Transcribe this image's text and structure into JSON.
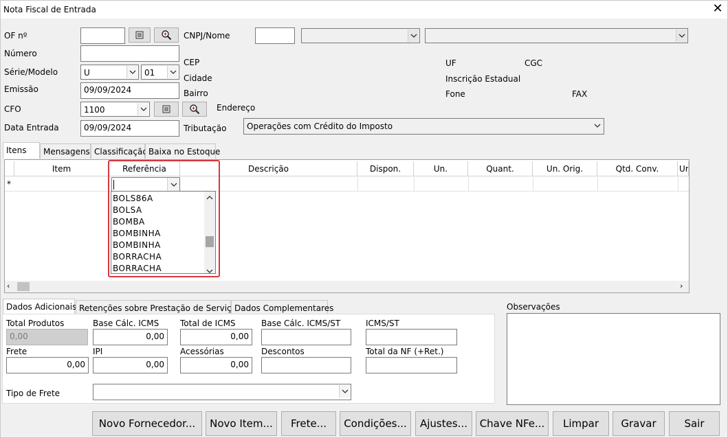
{
  "window": {
    "title": "Nota Fiscal de Entrada",
    "close": "✕"
  },
  "header": {
    "of_label": "OF nº",
    "numero_label": "Número",
    "serie_label": "Série/Modelo",
    "serie_value": "U",
    "modelo_value": "01",
    "emissao_label": "Emissão",
    "emissao_value": "09/09/2024",
    "cfo_label": "CFO",
    "cfo_value": "1100",
    "data_entrada_label": "Data Entrada",
    "data_entrada_value": "09/09/2024",
    "cnpj_label": "CNPJ/Nome",
    "cep_label": "CEP",
    "cidade_label": "Cidade",
    "bairro_label": "Bairro",
    "endereco_label": "Endereço",
    "tributacao_label": "Tributação",
    "tributacao_value": "Operações com Crédito do Imposto",
    "uf_label": "UF",
    "cgc_label": "CGC",
    "ie_label": "Inscrição Estadual",
    "fone_label": "Fone",
    "fax_label": "FAX"
  },
  "tabs": [
    "Itens",
    "Mensagens",
    "Classificação",
    "Baixa no Estoque"
  ],
  "grid": {
    "columns": [
      "Item",
      "Referência",
      "Descrição",
      "Dispon.",
      "Un.",
      "Quant.",
      "Un. Orig.",
      "Qtd. Conv.",
      "Ur"
    ],
    "new_row_marker": "*",
    "dropdown_options": [
      "BOLS86A",
      "BOLSA",
      "BOMBA",
      "BOMBINHA",
      "BOMBINHA",
      "BORRACHA",
      "BORRACHA"
    ]
  },
  "bottom_tabs": [
    "Dados Adicionais",
    "Retenções sobre Prestação de Serviços",
    "Dados Complementares"
  ],
  "totals": {
    "total_produtos_label": "Total Produtos",
    "total_produtos_value": "0,00",
    "base_icms_label": "Base Cálc. ICMS",
    "base_icms_value": "0,00",
    "total_icms_label": "Total de ICMS",
    "total_icms_value": "0,00",
    "base_icms_st_label": "Base Cálc. ICMS/ST",
    "icms_st_label": "ICMS/ST",
    "frete_label": "Frete",
    "frete_value": "0,00",
    "ipi_label": "IPI",
    "ipi_value": "0,00",
    "acessorias_label": "Acessórias",
    "acessorias_value": "0,00",
    "descontos_label": "Descontos",
    "total_nf_label": "Total da NF (+Ret.)",
    "tipo_frete_label": "Tipo de Frete"
  },
  "observacoes_label": "Observações",
  "buttons": {
    "novo_fornecedor": "Novo Fornecedor...",
    "novo_item": "Novo Item...",
    "frete": "Frete...",
    "condicoes": "Condições...",
    "ajustes": "Ajustes...",
    "chave_nfe": "Chave NFe...",
    "limpar": "Limpar",
    "gravar": "Gravar",
    "sair": "Sair"
  },
  "colors": {
    "highlight_border": "#d9363e",
    "disabled_field": "#cfcfcf"
  },
  "icons": [
    "list-icon",
    "search-zoom-icon",
    "chevron-down-icon",
    "close-icon"
  ]
}
